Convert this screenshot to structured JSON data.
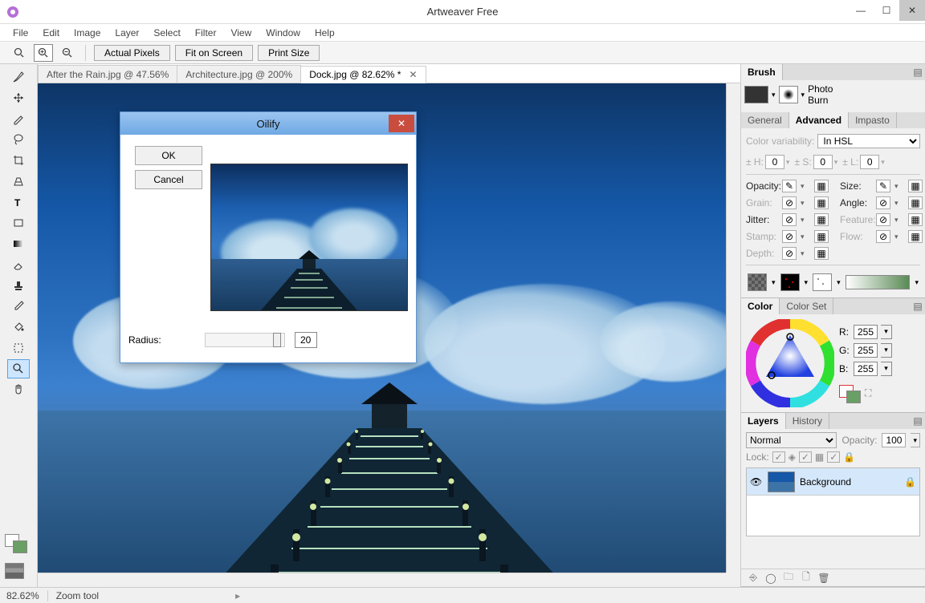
{
  "titlebar": {
    "title": "Artweaver Free"
  },
  "menu": {
    "items": [
      "File",
      "Edit",
      "Image",
      "Layer",
      "Select",
      "Filter",
      "View",
      "Window",
      "Help"
    ]
  },
  "toolbar": {
    "actual_pixels": "Actual Pixels",
    "fit_on_screen": "Fit on Screen",
    "print_size": "Print Size"
  },
  "doc_tabs": [
    {
      "label": "After the Rain.jpg @ 47.56%",
      "active": false
    },
    {
      "label": "Architecture.jpg @ 200%",
      "active": false
    },
    {
      "label": "Dock.jpg @ 82.62% *",
      "active": true
    }
  ],
  "dialog": {
    "title": "Oilify",
    "ok": "OK",
    "cancel": "Cancel",
    "radius_label": "Radius:",
    "radius_value": "20"
  },
  "brush_panel": {
    "tab": "Brush",
    "type1": "Photo",
    "type2": "Burn",
    "subtabs": {
      "general": "General",
      "advanced": "Advanced",
      "impasto": "Impasto"
    },
    "color_variability": "Color variability:",
    "color_var_mode": "In HSL",
    "hsl": {
      "h_label": "± H:",
      "h": "0",
      "s_label": "± S:",
      "s": "0",
      "l_label": "± L:",
      "l": "0"
    },
    "props": {
      "opacity": "Opacity:",
      "size": "Size:",
      "grain": "Grain:",
      "angle": "Angle:",
      "jitter": "Jitter:",
      "feature": "Feature:",
      "stamp": "Stamp:",
      "flow": "Flow:",
      "depth": "Depth:"
    }
  },
  "color_panel": {
    "tab_color": "Color",
    "tab_color_set": "Color Set",
    "r_label": "R:",
    "r": "255",
    "g_label": "G:",
    "g": "255",
    "b_label": "B:",
    "b": "255"
  },
  "layers_panel": {
    "tab_layers": "Layers",
    "tab_history": "History",
    "blend_mode": "Normal",
    "opacity_label": "Opacity:",
    "opacity": "100",
    "lock_label": "Lock:",
    "layer0": "Background"
  },
  "statusbar": {
    "zoom": "82.62%",
    "tool": "Zoom tool"
  }
}
